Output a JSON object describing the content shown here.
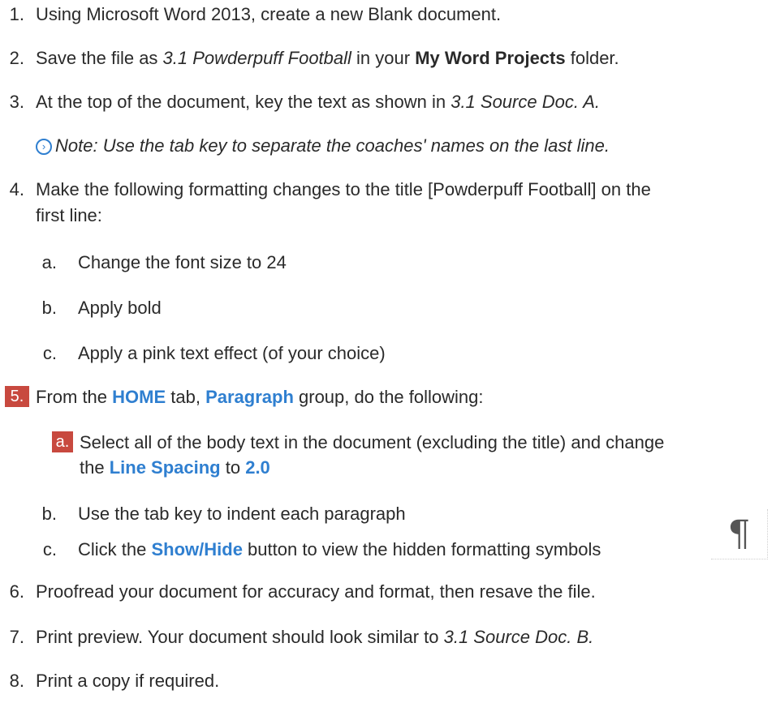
{
  "steps": [
    {
      "num": "1.",
      "text": "Using Microsoft Word 2013, create a new Blank document."
    },
    {
      "num": "2.",
      "text_a": "Save the file as ",
      "text_italic": "3.1 Powderpuff Football",
      "text_b": " in your ",
      "text_bold": "My Word Projects",
      "text_c": " folder."
    },
    {
      "num": "3.",
      "text_a": "At the top of the document, key the text as shown in ",
      "text_italic": "3.1 Source Doc. A."
    },
    {
      "note": "Note: Use the tab key to separate the coaches' names on the last line.",
      "note_icon": "circle-arrow-icon"
    },
    {
      "num": "4.",
      "line1": "Make the following formatting changes to the title [Powderpuff Football] on the",
      "line2": "first line:"
    },
    {
      "sub": [
        {
          "letter": "a.",
          "text": "Change the font size to 24"
        },
        {
          "letter": "b.",
          "text": "Apply bold"
        },
        {
          "letter": "c.",
          "text": "Apply a pink text effect (of your choice)"
        }
      ]
    },
    {
      "num": "5.",
      "text_a": "From the ",
      "home": "HOME",
      "text_b": " tab, ",
      "paragraph": "Paragraph",
      "text_c": " group, do the following:"
    },
    {
      "sub5": [
        {
          "letter": "a.",
          "line1": "Select all of the body text in the document (excluding the title) and change",
          "line2_a": "the ",
          "line2_blue": "Line Spacing",
          "line2_b": " to ",
          "line2_val": "2.0"
        },
        {
          "letter": "b.",
          "text": "Use the tab key to indent each paragraph"
        },
        {
          "letter": "c.",
          "text_a": "Click the ",
          "text_blue": "Show/Hide",
          "text_b": " button to view the hidden formatting symbols"
        }
      ]
    },
    {
      "num": "6.",
      "text": "Proofread your document for accuracy and format, then resave the file."
    },
    {
      "num": "7.",
      "text_a": "Print preview. Your document should look similar to ",
      "text_italic": "3.1 Source Doc. B."
    },
    {
      "num": "8.",
      "text": "Print a copy if required."
    }
  ],
  "colors": {
    "accent": "#2f7fd0",
    "badge": "#c8493f"
  },
  "pilcrow": {
    "symbol": "¶",
    "icon": "pilcrow-icon"
  }
}
